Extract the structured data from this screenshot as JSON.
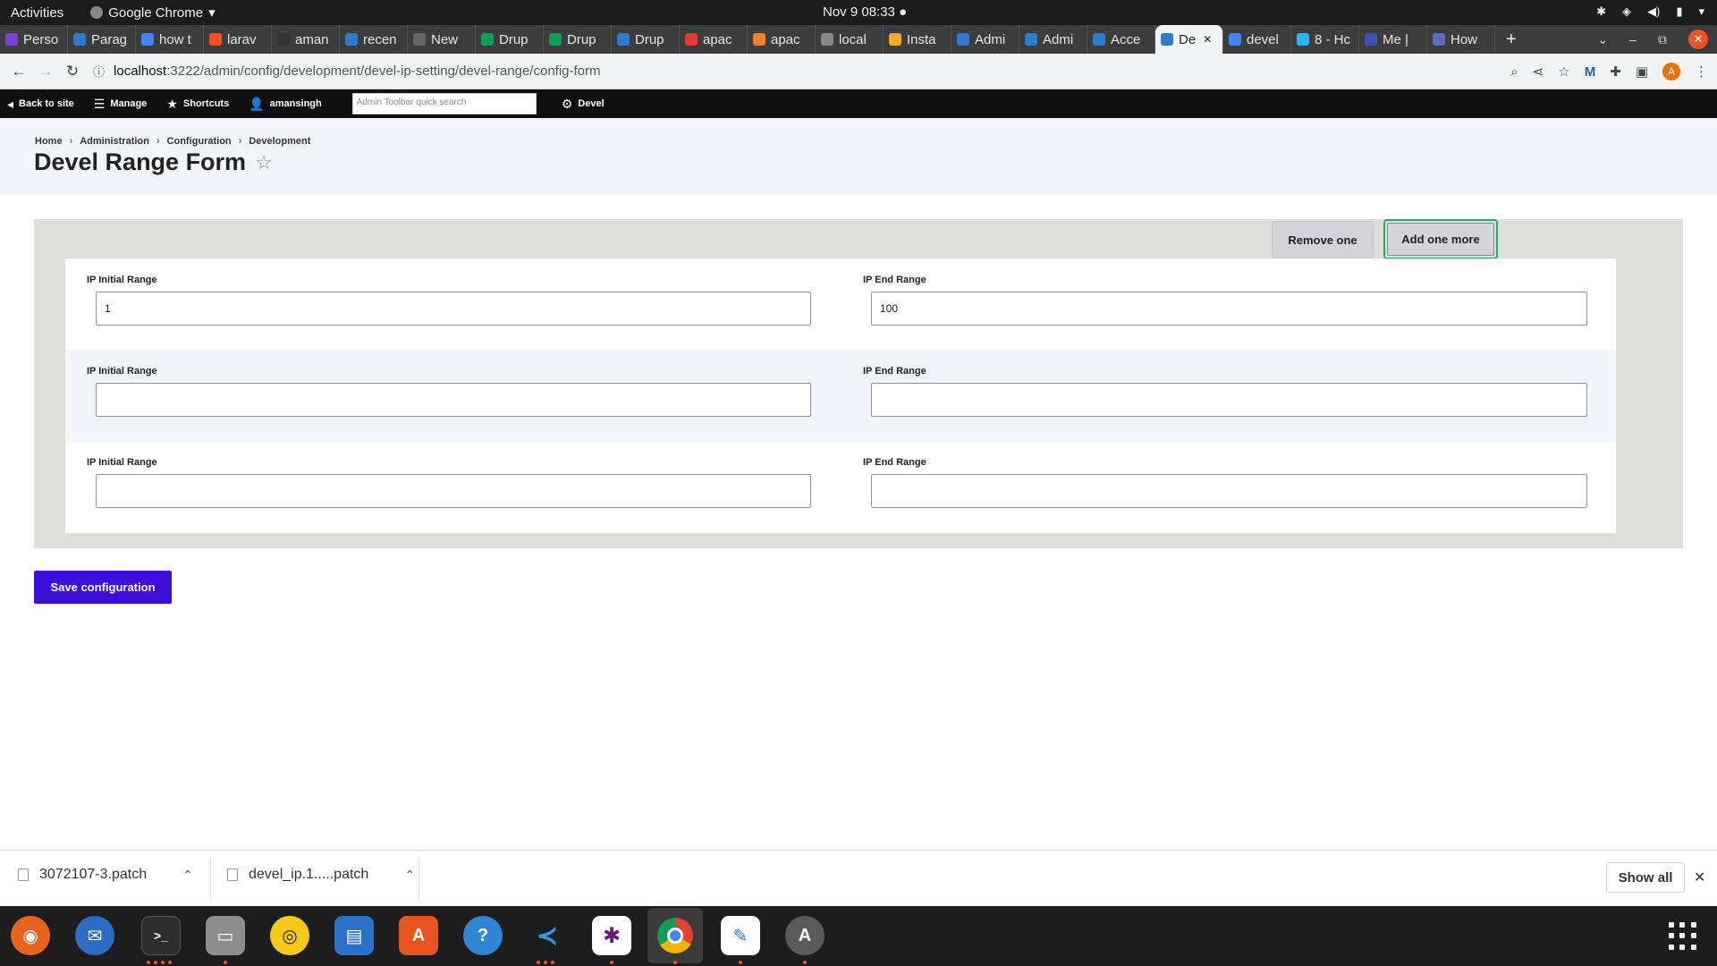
{
  "system": {
    "activities": "Activities",
    "app_name": "Google Chrome",
    "clock": "Nov 9  08:33"
  },
  "tabs": [
    {
      "label": "Perso",
      "color": "#7b3fd6"
    },
    {
      "label": "Parag",
      "color": "#2b7bd1"
    },
    {
      "label": "how t",
      "color": "#4285f4"
    },
    {
      "label": "larav",
      "color": "#f4511e"
    },
    {
      "label": "aman",
      "color": "#333333"
    },
    {
      "label": "recen",
      "color": "#2b7bd1"
    },
    {
      "label": "New",
      "color": "#666666"
    },
    {
      "label": "Drup",
      "color": "#0f9d58"
    },
    {
      "label": "Drup",
      "color": "#0f9d58"
    },
    {
      "label": "Drup",
      "color": "#2b7bd1"
    },
    {
      "label": "apac",
      "color": "#e53935"
    },
    {
      "label": "apac",
      "color": "#f48024"
    },
    {
      "label": "local",
      "color": "#888888"
    },
    {
      "label": "Insta",
      "color": "#f9a825"
    },
    {
      "label": "Admi",
      "color": "#2b7bd1"
    },
    {
      "label": "Admi",
      "color": "#2b7bd1"
    },
    {
      "label": "Acce",
      "color": "#2b7bd1"
    },
    {
      "label": "De",
      "color": "#2b7bd1",
      "active": true
    },
    {
      "label": "devel",
      "color": "#4285f4"
    },
    {
      "label": "8 - Hc",
      "color": "#29b6f6"
    },
    {
      "label": "Me |",
      "color": "#3f51b5"
    },
    {
      "label": "How",
      "color": "#5c6bc0"
    }
  ],
  "address": {
    "host": "localhost",
    "path": ":3222/admin/config/development/devel-ip-setting/devel-range/config-form"
  },
  "admin_toolbar": {
    "back_to_site": "Back to site",
    "manage": "Manage",
    "shortcuts": "Shortcuts",
    "user": "amansingh",
    "search_placeholder": "Admin Toolbar quick search",
    "devel": "Devel"
  },
  "breadcrumb": [
    "Home",
    "Administration",
    "Configuration",
    "Development"
  ],
  "page_title": "Devel Range Form",
  "form": {
    "remove_label": "Remove one",
    "add_label": "Add one more",
    "rows": [
      {
        "initial_label": "IP Initial Range",
        "initial_value": "1",
        "end_label": "IP End Range",
        "end_value": "100"
      },
      {
        "initial_label": "IP Initial Range",
        "initial_value": "",
        "end_label": "IP End Range",
        "end_value": ""
      },
      {
        "initial_label": "IP Initial Range",
        "initial_value": "",
        "end_label": "IP End Range",
        "end_value": ""
      }
    ],
    "save_label": "Save configuration"
  },
  "downloads": {
    "items": [
      "3072107-3.patch",
      "devel_ip.1.....patch"
    ],
    "show_all": "Show all"
  },
  "dock": {
    "apps": [
      "firefox",
      "thunderbird",
      "terminal",
      "files",
      "rhythmbox",
      "writer",
      "app-center",
      "help",
      "vscode",
      "slack",
      "chrome",
      "text-editor",
      "updater"
    ]
  },
  "colors": {
    "accent": "#3b0fd8",
    "focus_ring": "#26a769",
    "ubuntu_orange": "#e95420"
  }
}
